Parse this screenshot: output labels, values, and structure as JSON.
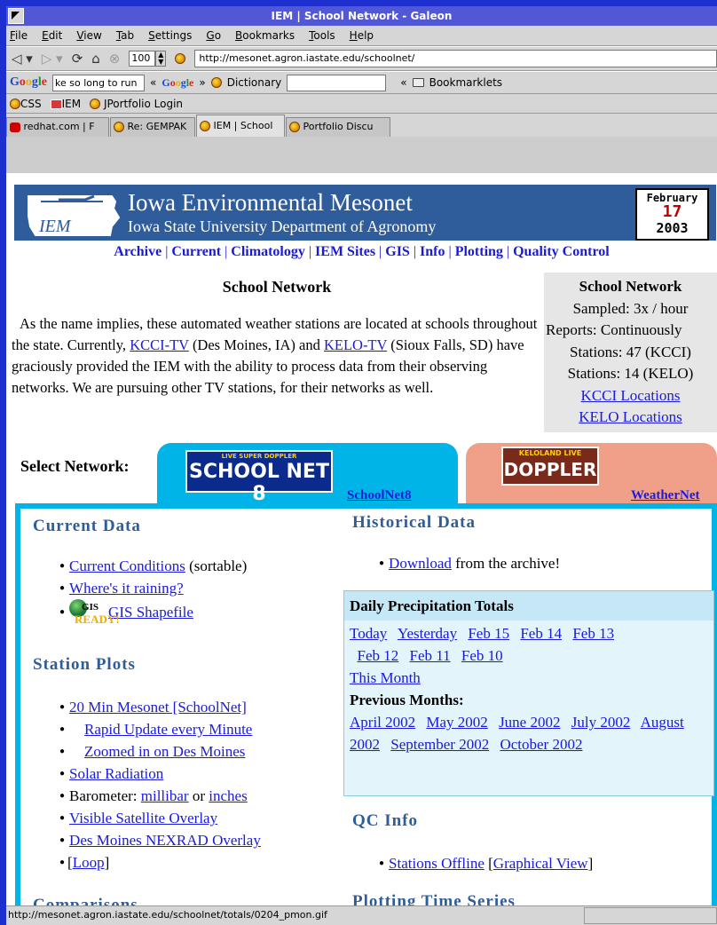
{
  "window": {
    "title": "IEM | School Network - Galeon"
  },
  "menu": [
    "File",
    "Edit",
    "View",
    "Tab",
    "Settings",
    "Go",
    "Bookmarks",
    "Tools",
    "Help"
  ],
  "nav": {
    "zoom": "100",
    "url": "http://mesonet.agron.iastate.edu/schoolnet/"
  },
  "googlebar": {
    "search_value": "ke so long to run",
    "goto": "«",
    "forward": "»",
    "dictionary": "Dictionary",
    "bookmarklets": "Bookmarklets",
    "bookmarklets_prefix": "«"
  },
  "bookmarks": [
    "CSS",
    "IEM",
    "JPortfolio Login"
  ],
  "tabs": [
    "redhat.com | F",
    "Re: GEMPAK",
    "IEM | School",
    "Portfolio Discu"
  ],
  "status": {
    "text": "http://mesonet.agron.iastate.edu/schoolnet/totals/0204_pmon.gif"
  },
  "banner": {
    "logo_text": "IEM",
    "title": "Iowa Environmental Mesonet",
    "subtitle": "Iowa State University Department of Agronomy",
    "cal_month": "February",
    "cal_day": "17",
    "cal_year": "2003"
  },
  "topnav": [
    "Archive",
    "Current",
    "Climatology",
    "IEM Sites",
    "GIS",
    "Info",
    "Plotting",
    "Quality Control"
  ],
  "intro": {
    "title": "School Network",
    "p1": "As the name implies, these automated weather stations are located at schools throughout the state. Currently, ",
    "link1": "KCCI-TV",
    "p2": " (Des Moines, IA) and ",
    "link2": "KELO-TV",
    "p3": " (Sioux Falls, SD) have graciously provided the IEM with the ability to process data from their observing networks. We are pursuing other TV stations, for their networks as well."
  },
  "infobox": {
    "title": "School Network",
    "sampled": "Sampled: 3x / hour",
    "reports": "Reports: Continuously",
    "st_kcci": "Stations: 47 (KCCI)",
    "st_kelo": "Stations: 14 (KELO)",
    "kcci_loc": "KCCI Locations",
    "kelo_loc": "KELO Locations"
  },
  "network": {
    "select_label": "Select Network:",
    "tab1_logo_small": "LIVE SUPER DOPPLER",
    "tab1_logo": "SCHOOL NET 8",
    "tab1_label": "SchoolNet8",
    "tab2_logo_small": "KELOLAND LIVE",
    "tab2_logo": "DOPPLER",
    "tab2_label": "WeatherNet"
  },
  "current": {
    "title": "Current Data",
    "cc_link": "Current Conditions",
    "cc_suffix": " (sortable)",
    "raining": "Where's it raining?",
    "gis_badge_top": "GIS",
    "gis_badge_bottom": "READY!",
    "gis_link": "GIS Shapefile"
  },
  "plots": {
    "title": "Station Plots",
    "mesonet": "20 Min Mesonet [SchoolNet]",
    "rapid": "Rapid Update every Minute",
    "zoomed": "Zoomed in on Des Moines",
    "solar": "Solar Radiation",
    "baro_prefix": "Barometer: ",
    "millibar": "millibar",
    "baro_or": " or ",
    "inches": "inches",
    "visible": "Visible Satellite Overlay",
    "nexrad": "Des Moines NEXRAD Overlay",
    "loop": "Loop",
    "cut_heading": "Comparisons"
  },
  "historical": {
    "title": "Historical Data",
    "download": "Download",
    "download_suffix": " from the archive!"
  },
  "precip": {
    "title": "Daily Precipitation Totals",
    "days": [
      "Today",
      "Yesterday",
      "Feb 15",
      "Feb 14",
      "Feb 13",
      "Feb 12",
      "Feb 11",
      "Feb 10"
    ],
    "this_month": "This Month",
    "prev_title": "Previous Months:",
    "months": [
      "April 2002",
      "May 2002",
      "June 2002",
      "July 2002",
      "August 2002",
      "September 2002",
      "October 2002"
    ]
  },
  "qc": {
    "title": "QC Info",
    "offline": "Stations Offline",
    "graphical": "Graphical View"
  },
  "plotting": {
    "title": "Plotting Time Series"
  }
}
